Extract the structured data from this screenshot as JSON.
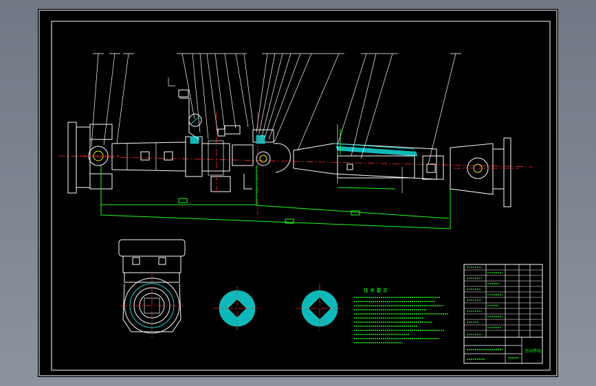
{
  "drawing": {
    "tech_requirements_title": "技 术 要 求",
    "tech_requirement_lines": 13,
    "title_block_label": "万向传动",
    "part_label_count": 22,
    "colors": {
      "background": "#000000",
      "viewport": "#7c8591",
      "outline": "#ffffff",
      "dimension": "#19ff19",
      "centerline": "#ff2a2a",
      "hatch": "#14d6d6"
    }
  }
}
